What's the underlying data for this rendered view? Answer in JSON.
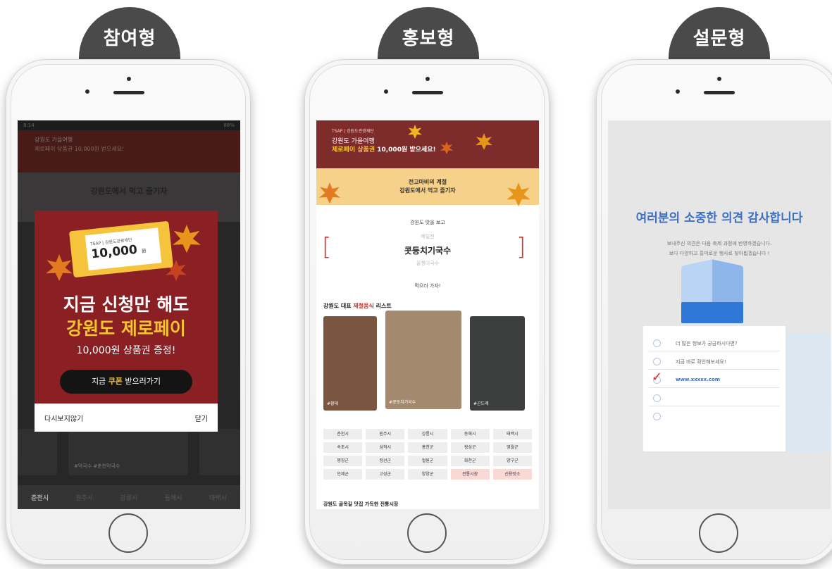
{
  "tabs": [
    "참여형",
    "홍보형",
    "설문형"
  ],
  "participation": {
    "status_time": "8:14",
    "status_right": "88%",
    "bg_banner_line1": "강원도 가을여행",
    "bg_banner_line2": "제로페이 상품권 10,000원 받으세요!",
    "bg_sub_title": "강원도에서 먹고 즐기자",
    "coupon_brand": "TSAP | 강원도관광재단",
    "coupon_amount": "10,000",
    "coupon_unit": "원",
    "headline_1": "지금 신청만 해도",
    "headline_2": "강원도 제로페이",
    "headline_3": "10,000원 상품권 증정!",
    "cta_pre": "지금 ",
    "cta_highlight": "쿠폰",
    "cta_post": " 받으러가기",
    "footer_left": "다시보지않기",
    "footer_right": "닫기",
    "card_labels": [
      "춘천시",
      "#막국수 #춘천막국수"
    ],
    "bottom_nav": [
      "춘천시",
      "원주시",
      "강릉시",
      "동해시",
      "태백시"
    ],
    "bottom_nav_active": 0
  },
  "promo": {
    "banner_line1": "TSAP | 강원도관광재단",
    "banner_line2": "강원도 가을여행",
    "banner_highlight": "제로페이 상품권",
    "banner_line3_rest": " 10,000원 받으세요!",
    "banner2_line1": "천고마비의 계절",
    "banner2_line2": "강원도에서 먹고 즐기자",
    "tag_top": "강원도 맛을 보고",
    "word_above": "메밀전",
    "main_word": "콧등치기국수",
    "word_below": "올챙이국수",
    "tag_bottom": "먹으러 가자!",
    "list_title_pre": "강원도 대표 ",
    "list_title_red": "제철음식",
    "list_title_post": " 리스트",
    "food_captions": [
      "#황태",
      "#콧등치기국수",
      "#곤드레"
    ],
    "regions": [
      "춘천시",
      "원주시",
      "강릉시",
      "동해시",
      "태백시",
      "속초시",
      "삼척시",
      "홍천군",
      "횡성군",
      "영월군",
      "평창군",
      "정선군",
      "철원군",
      "화천군",
      "양구군",
      "인제군",
      "고성군",
      "양양군",
      "전통시장",
      "신용맛소"
    ],
    "trail_text": "강원도 골목길 맛집 가득한 전통시장"
  },
  "survey": {
    "title": "여러분의 소중한 의견 감사합니다",
    "sub_1": "보내주신 의견은 다음 축제 과정에 반영하겠습니다.",
    "sub_2": "보다 다양하고 흥미로운 행사로 찾아뵙겠습니다 !",
    "options": [
      "더 많은 정보가 궁금하시다면?",
      "지금 바로 확인해보세요!",
      "www.xxxxx.com",
      "",
      ""
    ],
    "checked_index": 2,
    "check_mark": "✓"
  },
  "colors": {
    "tab_bg": "#4a4a4a",
    "promo_red": "#8a1f24",
    "accent_yellow": "#f4c432",
    "survey_blue": "#3a6fc4"
  }
}
